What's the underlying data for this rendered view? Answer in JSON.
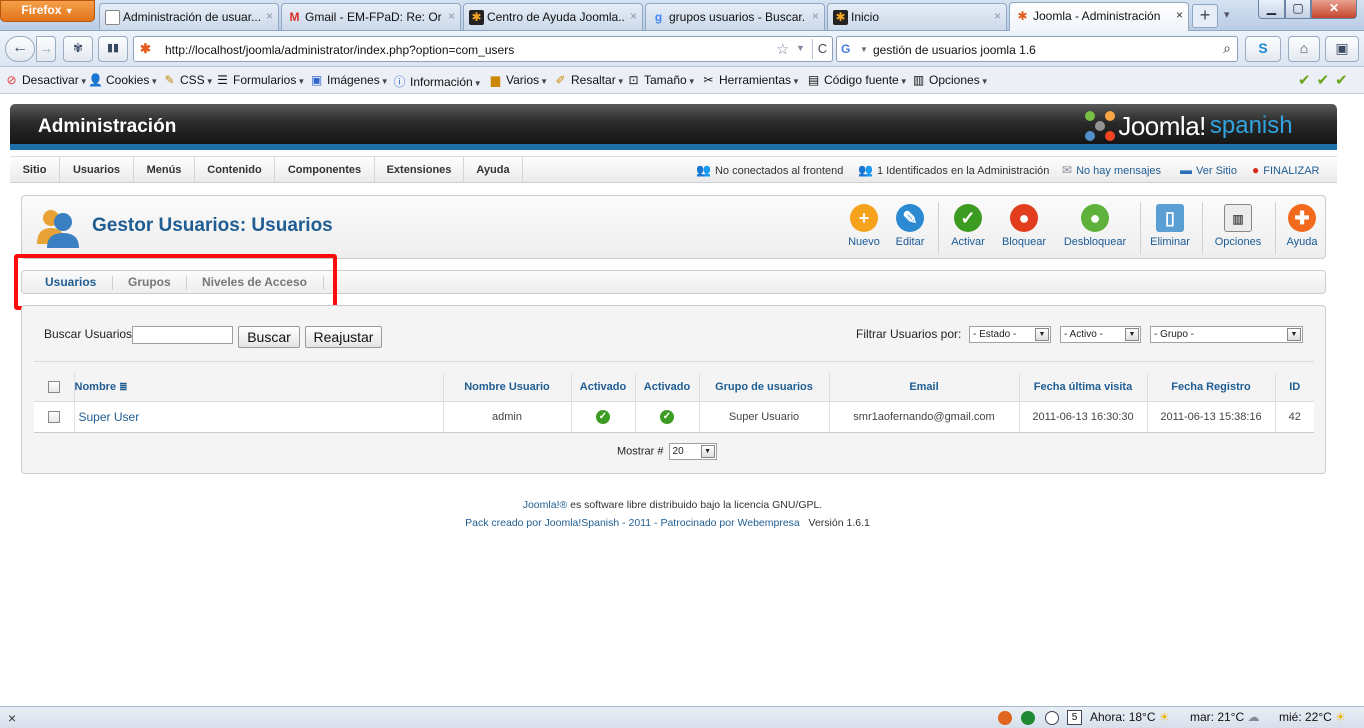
{
  "browser": {
    "app_button": "Firefox",
    "tabs": [
      {
        "title": "Administración de usuar..."
      },
      {
        "title": "Gmail - EM-FPaD: Re: Or..."
      },
      {
        "title": "Centro de Ayuda Joomla..."
      },
      {
        "title": "grupos usuarios - Buscar..."
      },
      {
        "title": "Inicio"
      },
      {
        "title": "Joomla - Administración"
      }
    ],
    "url": "http://localhost/joomla/administrator/index.php?option=com_users",
    "search_query": "gestión de usuarios joomla 1.6"
  },
  "bookmarks": [
    "Desactivar",
    "Cookies",
    "CSS",
    "Formularios",
    "Imágenes",
    "Información",
    "Varios",
    "Resaltar",
    "Tamaño",
    "Herramientas",
    "Código fuente",
    "Opciones"
  ],
  "header": {
    "title": "Administración",
    "logo_main": "Joomla!",
    "logo_sub": "spanish"
  },
  "menu": {
    "items": [
      "Sitio",
      "Usuarios",
      "Menús",
      "Contenido",
      "Componentes",
      "Extensiones",
      "Ayuda"
    ],
    "status": {
      "frontend": "No conectados al frontend",
      "admin": "1 Identificados en la Administración",
      "messages": "No hay mensajes",
      "view_site": "Ver Sitio",
      "logout": "FINALIZAR"
    }
  },
  "toolbar": {
    "title": "Gestor Usuarios: Usuarios",
    "buttons": [
      "Nuevo",
      "Editar",
      "Activar",
      "Bloquear",
      "Desbloquear",
      "Eliminar",
      "Opciones",
      "Ayuda"
    ]
  },
  "submenu": {
    "items": [
      "Usuarios",
      "Grupos",
      "Niveles de Acceso"
    ],
    "active": "Usuarios"
  },
  "filters": {
    "search_label": "Buscar Usuarios",
    "search_value": "",
    "search_button": "Buscar",
    "reset_button": "Reajustar",
    "filter_label": "Filtrar Usuarios por:",
    "estado": "- Estado -",
    "activo": "- Activo -",
    "grupo": "- Grupo -"
  },
  "table": {
    "columns": [
      "Nombre",
      "Nombre Usuario",
      "Activado",
      "Activado",
      "Grupo de usuarios",
      "Email",
      "Fecha última visita",
      "Fecha Registro",
      "ID"
    ],
    "rows": [
      {
        "nombre": "Super User",
        "usuario": "admin",
        "grupo": "Super Usuario",
        "email": "smr1aofernando@gmail.com",
        "ultima_visita": "2011-06-13 16:30:30",
        "registro": "2011-06-13 15:38:16",
        "id": "42"
      }
    ]
  },
  "pagination": {
    "label": "Mostrar #",
    "value": "20"
  },
  "footer": {
    "line1_link": "Joomla!®",
    "line1_text": "es software libre distribuido bajo la licencia GNU/GPL.",
    "line2_link": "Pack creado por Joomla!Spanish - 2011 - Patrocinado por Webempresa",
    "version": "Versión 1.6.1"
  },
  "statusbar": {
    "close": "×",
    "weather_now": "Ahora: 18°C",
    "weather_tue": "mar: 21°C",
    "weather_wed": "mié: 22°C",
    "calendar_day": "5"
  },
  "colors": {
    "accent": "#1f5d92",
    "highlight": "#ff0a0a",
    "header_bar": "#1f6fa8"
  }
}
